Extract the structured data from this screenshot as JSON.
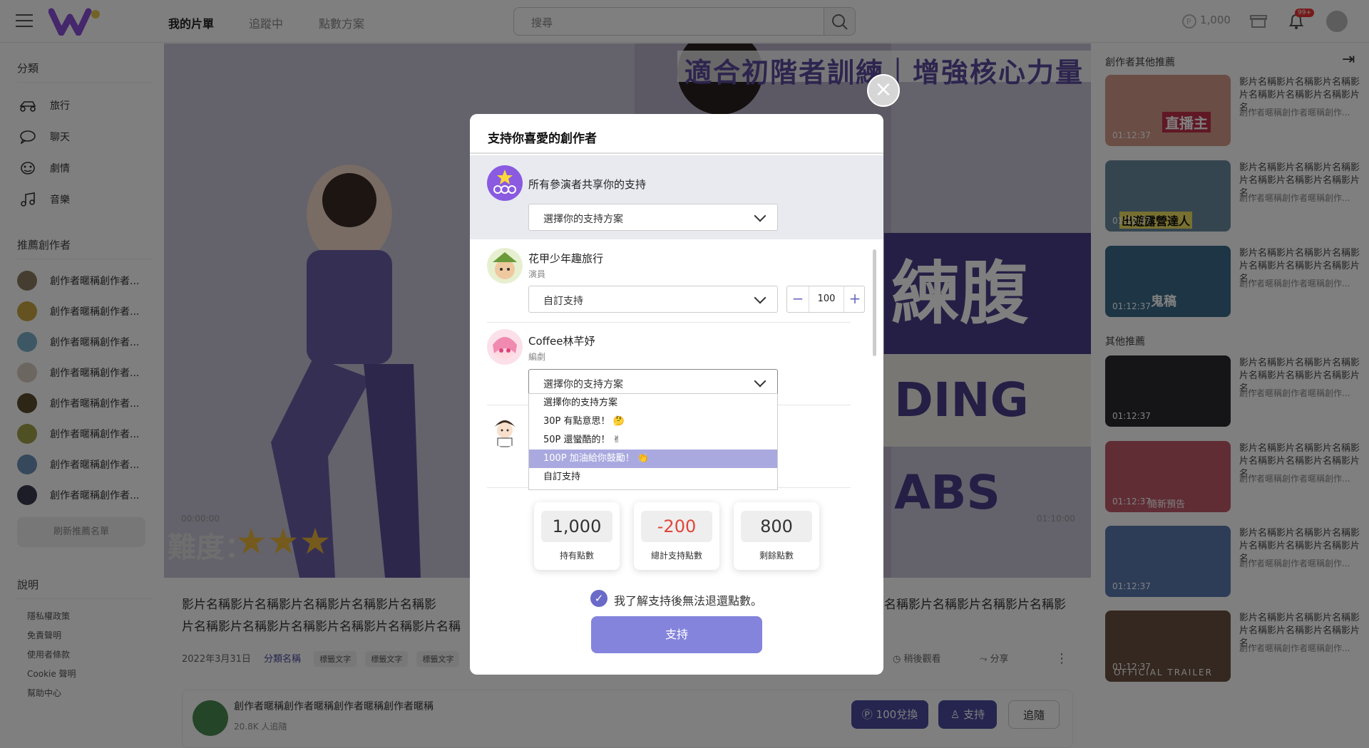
{
  "header": {
    "nav": [
      "我的片單",
      "追蹤中",
      "點數方案"
    ],
    "search_placeholder": "搜尋",
    "points": "1,000",
    "notif_badge": "99+"
  },
  "sidebar": {
    "category_title": "分類",
    "categories": [
      {
        "label": "旅行",
        "icon": "scooter-icon"
      },
      {
        "label": "聊天",
        "icon": "chat-icon"
      },
      {
        "label": "劇情",
        "icon": "theater-icon"
      },
      {
        "label": "音樂",
        "icon": "music-icon"
      }
    ],
    "creators_title": "推薦創作者",
    "creators": [
      "創作者暱稱創作者...",
      "創作者暱稱創作者...",
      "創作者暱稱創作者...",
      "創作者暱稱創作者...",
      "創作者暱稱創作者...",
      "創作者暱稱創作者...",
      "創作者暱稱創作者...",
      "創作者暱稱創作者..."
    ],
    "refresh_label": "刷新推薦名單",
    "info_title": "說明",
    "links": [
      "隱私權政策",
      "免責聲明",
      "使用者條款",
      "Cookie 聲明",
      "幫助中心"
    ]
  },
  "video": {
    "overlay_title": "適合初階者訓練｜增強核心力量",
    "banner_text": "練腹肌",
    "banner_sub": "DING ABS",
    "difficulty": "難度：",
    "time_current": "00:00:00",
    "time_total": "01:10:00"
  },
  "below": {
    "desc_left_1": "影片名稱影片名稱影片名稱影片名稱影片名稱影",
    "desc_left_2": "片名稱影片名稱影片名稱影片名稱影片名稱影片名稱",
    "desc_right_1": "名稱影片名稱影片名稱影片名稱影",
    "date": "2022年3月31日",
    "category": "分類名稱",
    "tags": [
      "標籤文字",
      "標籤文字",
      "標籤文字"
    ],
    "watch_later": "稍後觀看",
    "share": "分享",
    "creator_name": "創作者暱稱創作者暱稱創作者暱稱創作者暱稱",
    "followers": "20.8K 人追隨",
    "redeem": "100兌換",
    "support": "支持",
    "follow": "追隨"
  },
  "right": {
    "creator_title": "創作者其他推薦",
    "other_title": "其他推薦",
    "item_title": "影片名稱影片名稱影片名稱影片名稱影片名稱影片名稱影片名...",
    "item_sub": "創作者暱稱創作者暱稱創作...",
    "duration": "01:12:37",
    "thumb_texts": [
      "直播主",
      "出遊露營達人",
      "鬼稿",
      "",
      "",
      "簡新預告",
      "",
      "OFFICIAL TRAILER"
    ]
  },
  "modal": {
    "title": "支持你喜愛的創作者",
    "shared_label": "所有參演者共享你的支持",
    "shared_select": "選擇你的支持方案",
    "performers": [
      {
        "name": "花甲少年趣旅行",
        "role": "演員",
        "select": "自訂支持",
        "amount": "100"
      },
      {
        "name": "Coffee林芊妤",
        "role": "編劇",
        "select": "選擇你的支持方案"
      }
    ],
    "options": [
      "選擇你的支持方案",
      "30P 有點意思！ 🤔",
      "50P 還蠻酷的！ ✌",
      "100P 加油給你鼓勵！ 👏",
      "自訂支持"
    ],
    "summary": [
      {
        "value": "1,000",
        "label": "持有點數",
        "color": "#333333"
      },
      {
        "value": "-200",
        "label": "總計支持點數",
        "color": "#e0463a"
      },
      {
        "value": "800",
        "label": "剩餘點數",
        "color": "#333333"
      }
    ],
    "agree": "我了解支持後無法退還點數。",
    "submit": "支持",
    "minus": "−",
    "plus": "+"
  },
  "colors": {
    "accent": "#6a6ac8",
    "brand": "#8a4fd8",
    "submit": "#8484dd"
  }
}
